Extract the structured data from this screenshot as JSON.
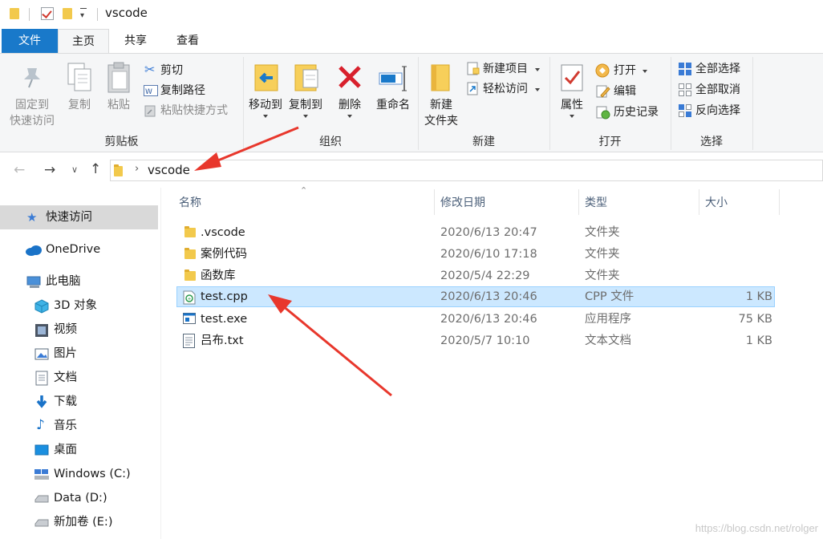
{
  "window": {
    "title": "vscode"
  },
  "ribbon_tabs": [
    "文件",
    "主页",
    "共享",
    "查看"
  ],
  "ribbon": {
    "clipboard": {
      "pin_label": "固定到\n快速访问",
      "copy_label": "复制",
      "paste_label": "粘贴",
      "cut_label": "剪切",
      "copy_path_label": "复制路径",
      "paste_shortcut_label": "粘贴快捷方式",
      "group_label": "剪贴板"
    },
    "organize": {
      "move_to_label": "移动到",
      "copy_to_label": "复制到",
      "delete_label": "删除",
      "rename_label": "重命名",
      "group_label": "组织"
    },
    "new": {
      "new_folder_label": "新建\n文件夹",
      "new_item_label": "新建项目",
      "easy_access_label": "轻松访问",
      "group_label": "新建"
    },
    "open": {
      "properties_label": "属性",
      "open_label": "打开",
      "edit_label": "编辑",
      "history_label": "历史记录",
      "group_label": "打开"
    },
    "select": {
      "select_all_label": "全部选择",
      "select_none_label": "全部取消",
      "invert_label": "反向选择",
      "group_label": "选择"
    }
  },
  "address": {
    "path": "vscode"
  },
  "sidebar": {
    "items": [
      {
        "label": "快速访问",
        "icon": "star-icon"
      },
      {
        "label": "OneDrive",
        "icon": "cloud-icon"
      },
      {
        "label": "此电脑",
        "icon": "computer-icon"
      },
      {
        "label": "3D 对象",
        "icon": "cube-icon"
      },
      {
        "label": "视频",
        "icon": "video-icon"
      },
      {
        "label": "图片",
        "icon": "picture-icon"
      },
      {
        "label": "文档",
        "icon": "document-icon"
      },
      {
        "label": "下载",
        "icon": "download-icon"
      },
      {
        "label": "音乐",
        "icon": "music-icon"
      },
      {
        "label": "桌面",
        "icon": "desktop-icon"
      },
      {
        "label": "Windows (C:)",
        "icon": "drive-icon"
      },
      {
        "label": "Data (D:)",
        "icon": "drive-icon"
      },
      {
        "label": "新加卷 (E:)",
        "icon": "drive-icon"
      }
    ]
  },
  "columns": {
    "name": "名称",
    "date": "修改日期",
    "type": "类型",
    "size": "大小"
  },
  "files": [
    {
      "name": ".vscode",
      "date": "2020/6/13 20:47",
      "type": "文件夹",
      "size": "",
      "icon": "folder-icon"
    },
    {
      "name": "案例代码",
      "date": "2020/6/10 17:18",
      "type": "文件夹",
      "size": "",
      "icon": "folder-icon"
    },
    {
      "name": "函数库",
      "date": "2020/5/4 22:29",
      "type": "文件夹",
      "size": "",
      "icon": "folder-icon"
    },
    {
      "name": "test.cpp",
      "date": "2020/6/13 20:46",
      "type": "CPP 文件",
      "size": "1 KB",
      "icon": "cpp-file-icon",
      "selected": true
    },
    {
      "name": "test.exe",
      "date": "2020/6/13 20:46",
      "type": "应用程序",
      "size": "75 KB",
      "icon": "exe-file-icon"
    },
    {
      "name": "吕布.txt",
      "date": "2020/5/7 10:10",
      "type": "文本文档",
      "size": "1 KB",
      "icon": "text-file-icon"
    }
  ],
  "watermark": "https://blog.csdn.net/rolger",
  "colors": {
    "accent": "#1979ca",
    "selection": "#cce8ff",
    "annotation_arrow": "#e8372c"
  }
}
